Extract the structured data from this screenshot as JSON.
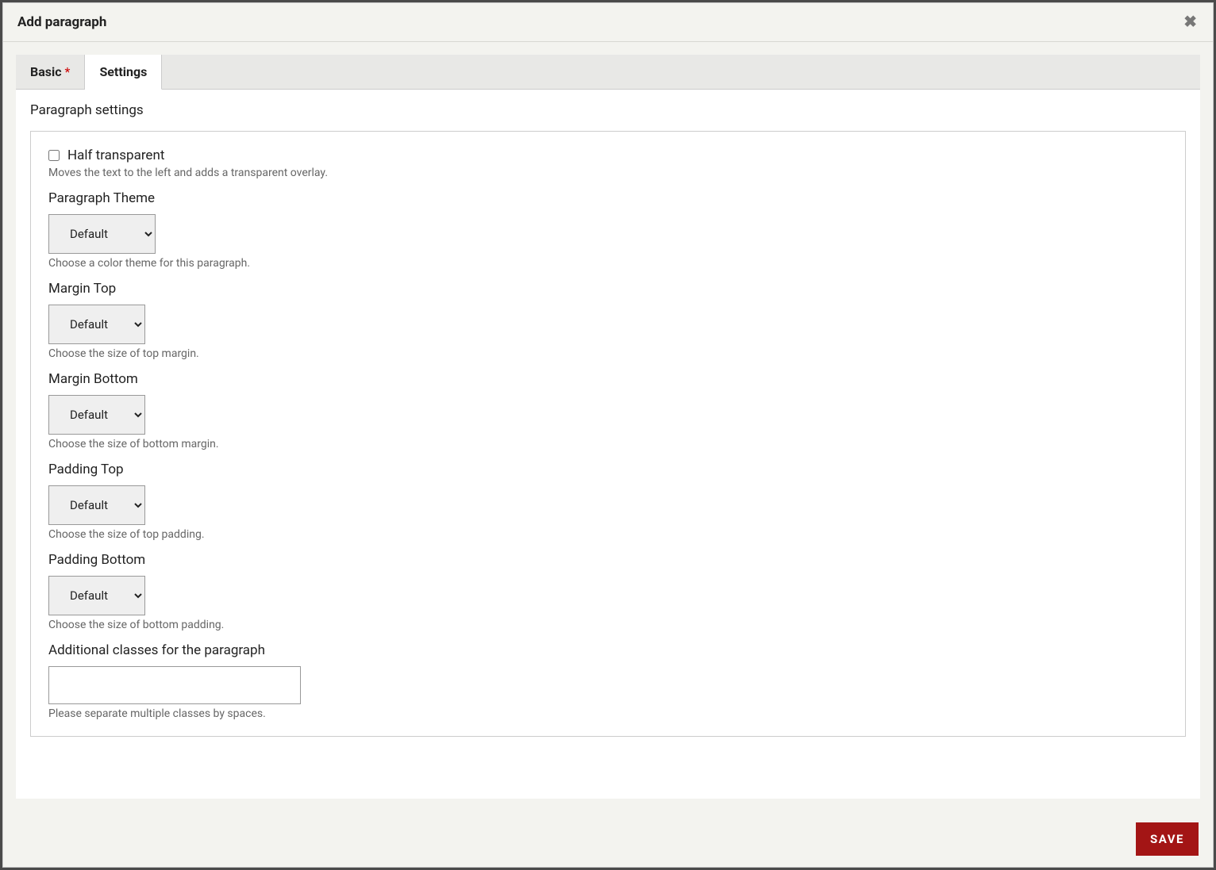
{
  "dialog": {
    "title": "Add paragraph"
  },
  "tabs": {
    "basic_label": "Basic",
    "settings_label": "Settings"
  },
  "section": {
    "title": "Paragraph settings"
  },
  "fields": {
    "half_transparent": {
      "label": "Half transparent",
      "help": "Moves the text to the left and adds a transparent overlay."
    },
    "paragraph_theme": {
      "label": "Paragraph Theme",
      "value": "Default",
      "help": "Choose a color theme for this paragraph."
    },
    "margin_top": {
      "label": "Margin Top",
      "value": "Default",
      "help": "Choose the size of top margin."
    },
    "margin_bottom": {
      "label": "Margin Bottom",
      "value": "Default",
      "help": "Choose the size of bottom margin."
    },
    "padding_top": {
      "label": "Padding Top",
      "value": "Default",
      "help": "Choose the size of top padding."
    },
    "padding_bottom": {
      "label": "Padding Bottom",
      "value": "Default",
      "help": "Choose the size of bottom padding."
    },
    "additional_classes": {
      "label": "Additional classes for the paragraph",
      "value": "",
      "help": "Please separate multiple classes by spaces."
    }
  },
  "footer": {
    "save_label": "Save"
  }
}
